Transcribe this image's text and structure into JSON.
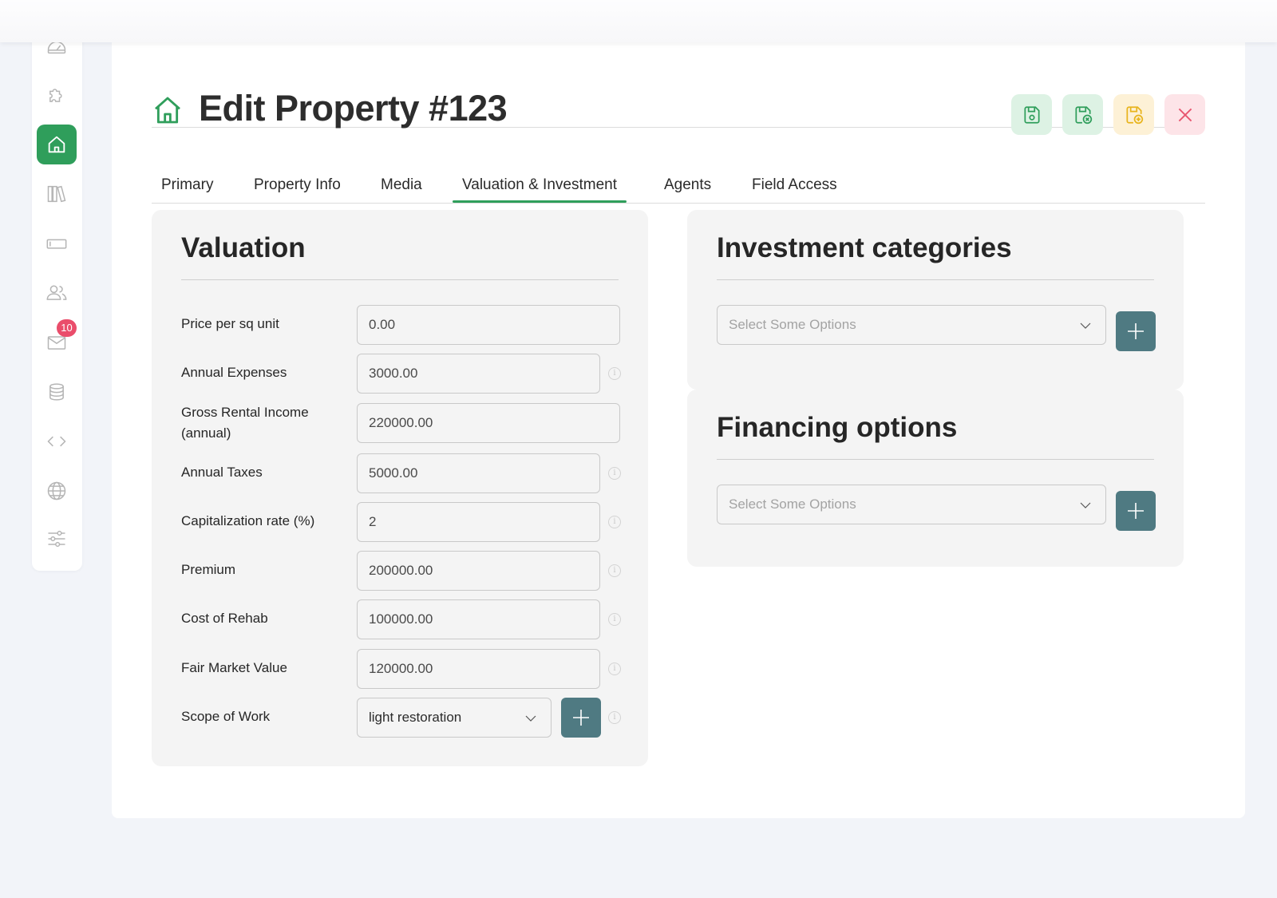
{
  "page": {
    "title": "Edit Property #123"
  },
  "sidebar": {
    "items": [
      {
        "icon": "dashboard-icon"
      },
      {
        "icon": "puzzle-icon"
      },
      {
        "icon": "home-icon",
        "active": true
      },
      {
        "icon": "library-icon"
      },
      {
        "icon": "card-icon"
      },
      {
        "icon": "users-icon"
      },
      {
        "icon": "mail-icon",
        "badge": "10"
      },
      {
        "icon": "database-icon"
      },
      {
        "icon": "code-icon"
      },
      {
        "icon": "globe-icon"
      },
      {
        "icon": "sliders-icon"
      }
    ]
  },
  "toolbar": {
    "buttons": [
      "save-icon",
      "save-close-icon",
      "save-new-icon",
      "close-icon"
    ]
  },
  "tabs": [
    {
      "label": "Primary"
    },
    {
      "label": "Property Info"
    },
    {
      "label": "Media"
    },
    {
      "label": "Valuation & Investment",
      "active": true
    },
    {
      "label": "Agents"
    },
    {
      "label": "Field Access"
    }
  ],
  "valuation": {
    "title": "Valuation",
    "fields": [
      {
        "label": "Price per sq unit",
        "value": "0.00"
      },
      {
        "label": "Annual Expenses",
        "value": "3000.00"
      },
      {
        "label": "Gross Rental Income (annual)",
        "value": "220000.00"
      },
      {
        "label": "Annual Taxes",
        "value": "5000.00"
      },
      {
        "label": "Capitalization rate (%)",
        "value": "2"
      },
      {
        "label": "Premium",
        "value": "200000.00"
      },
      {
        "label": "Cost of Rehab",
        "value": "100000.00"
      },
      {
        "label": "Fair Market Value",
        "value": "120000.00"
      },
      {
        "label": "Scope of Work",
        "value": "light restoration"
      }
    ]
  },
  "investment": {
    "title": "Investment categories",
    "placeholder": "Select Some Options"
  },
  "financing": {
    "title": "Financing options",
    "placeholder": "Select Some Options"
  },
  "colors": {
    "accent": "#2f9e5b",
    "add_button": "#4f7a82",
    "badge": "#ea4d6b",
    "card_bg": "#f4f4f4"
  }
}
